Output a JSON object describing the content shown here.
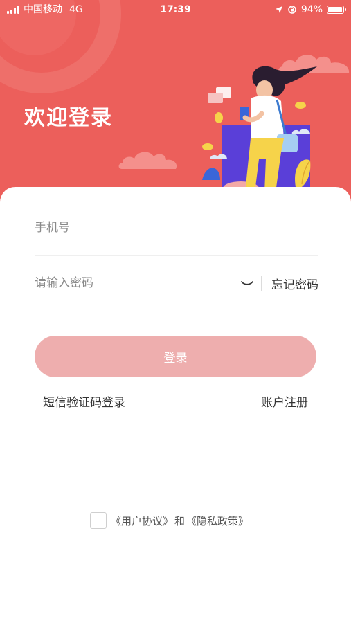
{
  "status_bar": {
    "carrier": "中国移动",
    "network": "4G",
    "time": "17:39",
    "battery": "94%",
    "battery_level": 0.94
  },
  "header": {
    "title": "欢迎登录"
  },
  "form": {
    "phone_placeholder": "手机号",
    "password_placeholder": "请输入密码",
    "forgot_label": "忘记密码",
    "login_label": "登录",
    "sms_login_label": "短信验证码登录",
    "register_label": "账户注册"
  },
  "agreement": {
    "user_agreement": "《用户协议》",
    "conjunction": "和",
    "privacy_policy": "《隐私政策》"
  },
  "colors": {
    "header_bg": "#ec5f5b",
    "button_bg": "#eeaeae"
  }
}
